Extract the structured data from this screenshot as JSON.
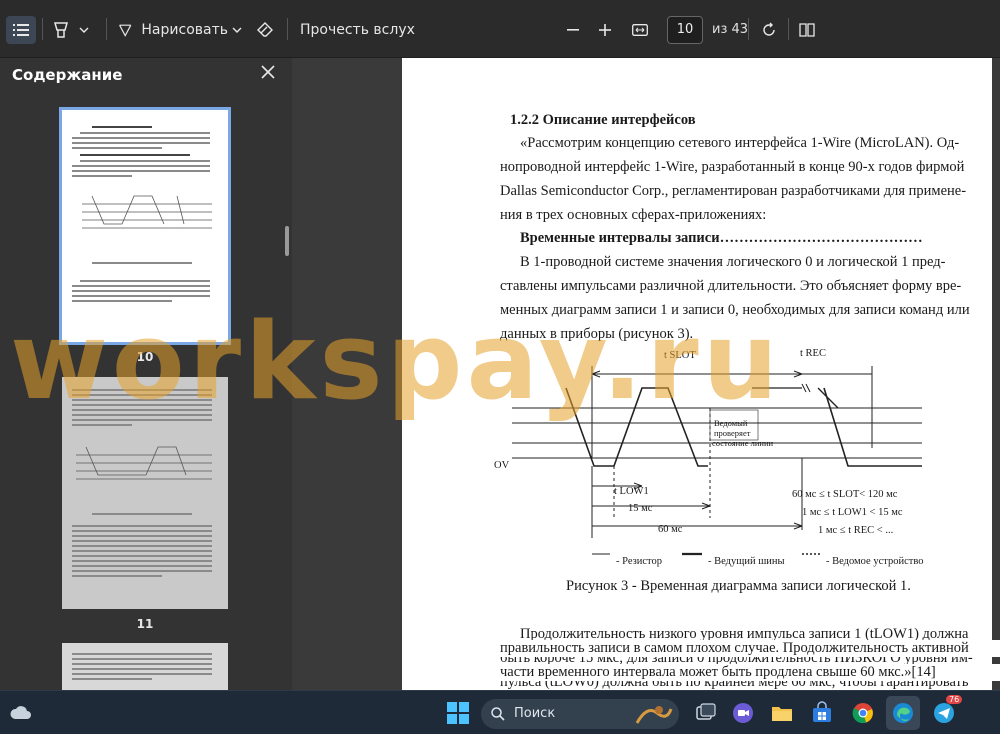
{
  "toolbar": {
    "draw_label": "Нарисовать",
    "read_aloud_label": "Прочесть вслух",
    "current_page": "10",
    "page_of": "из 43"
  },
  "sidebar": {
    "title": "Содержание",
    "thumbnails": [
      {
        "number": "10",
        "selected": true
      },
      {
        "number": "11",
        "selected": false
      }
    ]
  },
  "document": {
    "heading": "1.2.2 Описание интерфейсов",
    "intro_lines": [
      "«Рассмотрим концепцию сетевого интерфейса 1-Wire (MicroLAN). Од-",
      "нопроводной интерфейс 1-Wire, разработанный в конце 90-х годов фирмой",
      "Dallas Semiconductor Corp.,   регламентирован разработчиками для примене-",
      "ния в трех основных сферах-приложениях:"
    ],
    "subheading": "Временные интервалы записи……………………………………",
    "para2_lines": [
      "В 1-проводной системе значения логического 0 и логической 1 пред-",
      "ставлены импульсами различной длительности. Это объясняет форму вре-",
      "менных диаграмм записи 1 и записи 0, необходимых для записи команд или",
      "данных в приборы (рисунок 3)."
    ],
    "diagram": {
      "t_slot": "t SLOT",
      "t_rec": "t REC",
      "master_note_1": "Ведомый",
      "master_note_2": "проверяет",
      "master_note_3": "состояние линии",
      "ov": "OV",
      "t_low1": "t LOW1",
      "ms15": "15 мс",
      "ms60": "60 мс",
      "cond1": "60 мс ≤ t SLOT< 120 мс",
      "cond2": "1 мс ≤ t LOW1 < 15 мс",
      "cond3": "1 мс ≤ t REC <  ...",
      "legend_resistor": "- Резистор",
      "legend_master": "- Ведущий шины",
      "legend_slave": "- Ведомое устройство"
    },
    "caption": "Рисунок 3  - Временная диаграмма записи логической 1.",
    "para3_lines": [
      "Продолжительность низкого уровня импульса записи 1 (tLOW1) должна",
      "быть короче 15 мкс; для записи 0 продолжительность НИЗКОГО уровня им-",
      "пульса (tLOW0) должна быть по крайней мере 60 мкс, чтобы гарантировать",
      "правильность записи в самом плохом случае. Продолжительность активной",
      "части временного интервала может быть продлена свыше 60 мкс.»[14]"
    ]
  },
  "watermark": "workspay.ru",
  "taskbar": {
    "search_label": "Поиск",
    "telegram_badge": "76"
  }
}
